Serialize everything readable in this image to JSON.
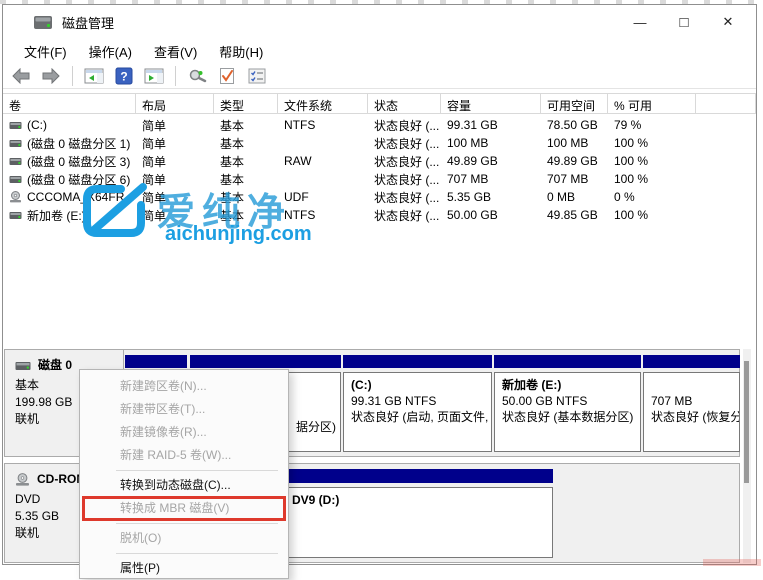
{
  "window": {
    "title": "磁盘管理",
    "controls": {
      "minimize": "—",
      "maximize": "□",
      "close": "✕"
    }
  },
  "menubar": {
    "items": [
      {
        "label": "文件(F)"
      },
      {
        "label": "操作(A)"
      },
      {
        "label": "查看(V)"
      },
      {
        "label": "帮助(H)"
      }
    ]
  },
  "toolbar": {
    "icons": [
      {
        "name": "back-icon"
      },
      {
        "name": "forward-icon"
      },
      {
        "name": "console-tree-icon"
      },
      {
        "name": "help-icon"
      },
      {
        "name": "action-pane-icon"
      },
      {
        "name": "rescan-icon"
      },
      {
        "name": "check-document-icon"
      },
      {
        "name": "checklist-icon"
      }
    ]
  },
  "table": {
    "columns": [
      "卷",
      "布局",
      "类型",
      "文件系统",
      "状态",
      "容量",
      "可用空间",
      "% 可用"
    ],
    "rows": [
      {
        "icon": "drive",
        "volume": "(C:)",
        "layout": "简单",
        "type": "基本",
        "fs": "NTFS",
        "status": "状态良好 (...",
        "capacity": "99.31 GB",
        "free": "78.50 GB",
        "pct": "79 %"
      },
      {
        "icon": "drive",
        "volume": "(磁盘 0 磁盘分区 1)",
        "layout": "简单",
        "type": "基本",
        "fs": "",
        "status": "状态良好 (...",
        "capacity": "100 MB",
        "free": "100 MB",
        "pct": "100 %"
      },
      {
        "icon": "drive",
        "volume": "(磁盘 0 磁盘分区 3)",
        "layout": "简单",
        "type": "基本",
        "fs": "RAW",
        "status": "状态良好 (...",
        "capacity": "49.89 GB",
        "free": "49.89 GB",
        "pct": "100 %"
      },
      {
        "icon": "drive",
        "volume": "(磁盘 0 磁盘分区 6)",
        "layout": "简单",
        "type": "基本",
        "fs": "",
        "status": "状态良好 (...",
        "capacity": "707 MB",
        "free": "707 MB",
        "pct": "100 %"
      },
      {
        "icon": "cd",
        "volume": "CCCOMA_X64FR...",
        "layout": "简单",
        "type": "基本",
        "fs": "UDF",
        "status": "状态良好 (...",
        "capacity": "5.35 GB",
        "free": "0 MB",
        "pct": "0 %"
      },
      {
        "icon": "drive",
        "volume": "新加卷 (E:)",
        "layout": "简单",
        "type": "基本",
        "fs": "NTFS",
        "status": "状态良好 (...",
        "capacity": "50.00 GB",
        "free": "49.85 GB",
        "pct": "100 %"
      }
    ]
  },
  "watermark": {
    "text": "爱纯净",
    "domain": "aichunjing.com",
    "color": "#1c9fe2"
  },
  "disk0": {
    "name": "磁盘 0",
    "type": "基本",
    "size": "199.98 GB",
    "status": "联机",
    "partitions": [
      {
        "title": "",
        "size_fs": "",
        "status": ""
      },
      {
        "title": "",
        "size_fs": "",
        "status": "据分区)"
      },
      {
        "title": "(C:)",
        "size_fs": "99.31 GB NTFS",
        "status": "状态良好 (启动, 页面文件,"
      },
      {
        "title": "新加卷  (E:)",
        "size_fs": "50.00 GB NTFS",
        "status": "状态良好 (基本数据分区)"
      },
      {
        "title": "",
        "size_fs": "707 MB",
        "status": "状态良好 (恢复分区)"
      }
    ]
  },
  "cdrom": {
    "name": "CD-ROM 0",
    "type": "DVD",
    "size": "5.35 GB",
    "status": "联机",
    "media_label": "DV9  (D:)"
  },
  "context_menu": {
    "highlight_color": "#de392c",
    "items": [
      {
        "label": "新建跨区卷(N)...",
        "disabled": true
      },
      {
        "label": "新建带区卷(T)...",
        "disabled": true
      },
      {
        "label": "新建镜像卷(R)...",
        "disabled": true
      },
      {
        "label": "新建 RAID-5 卷(W)...",
        "disabled": true
      },
      {
        "label": "转换到动态磁盘(C)...",
        "disabled": false
      },
      {
        "label": "转换成 MBR 磁盘(V)",
        "disabled": true,
        "highlighted": true
      },
      {
        "label": "脱机(O)",
        "disabled": true
      },
      {
        "label": "属性(P)",
        "disabled": false
      }
    ]
  },
  "colors": {
    "partition_header": "#00008b",
    "highlight_red": "#de392c",
    "watermark_blue": "#1c9fe2"
  }
}
